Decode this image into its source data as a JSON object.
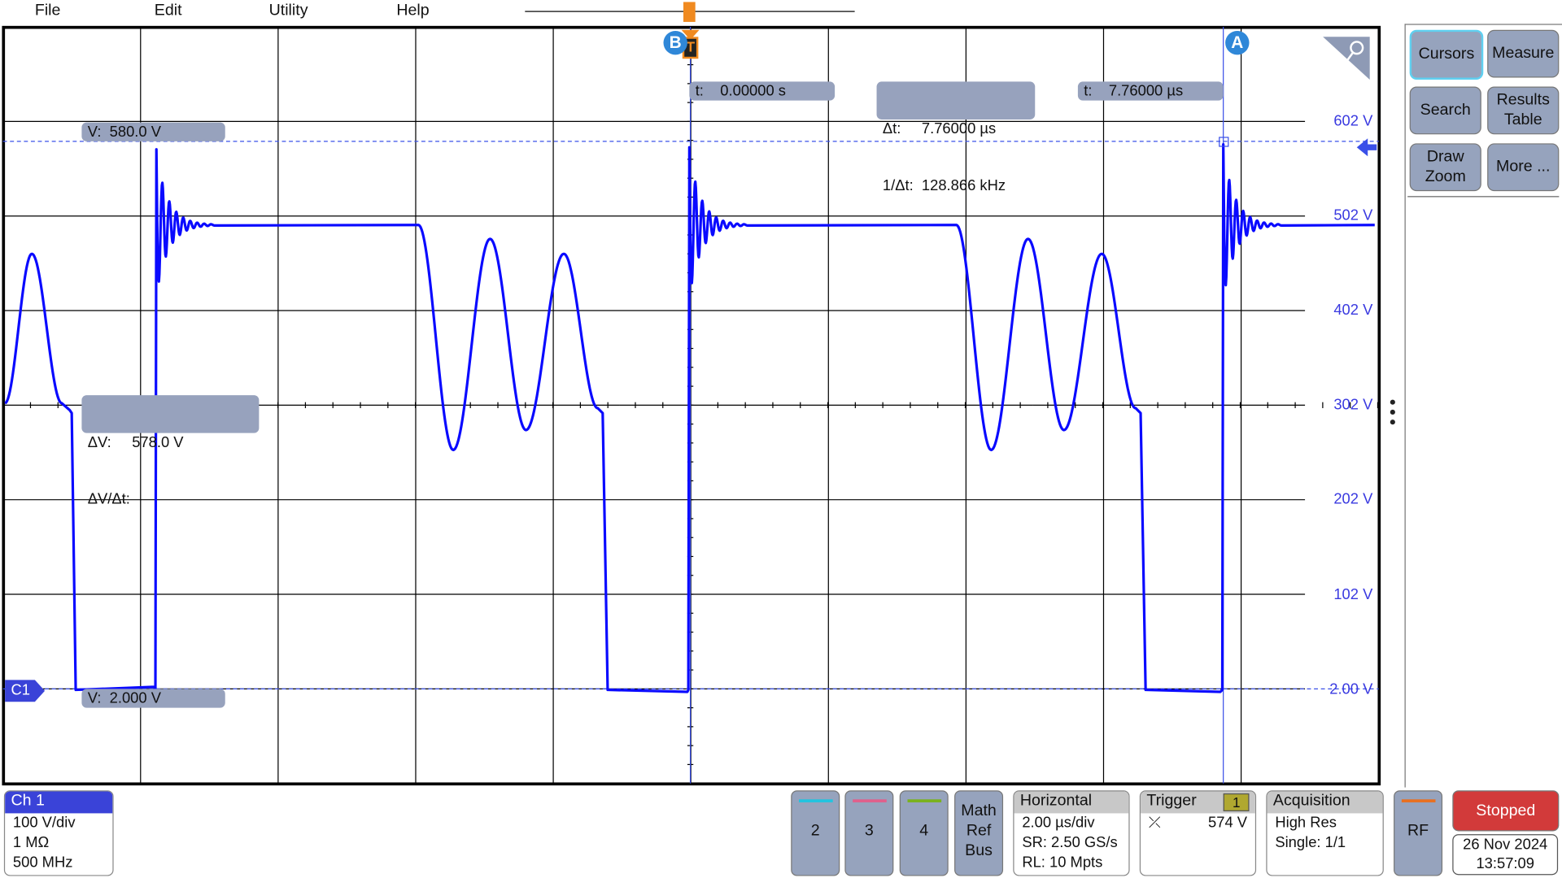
{
  "menu": [
    "File",
    "Edit",
    "Utility",
    "Help"
  ],
  "cursor_readouts": {
    "va": "V:  580.0 V",
    "dv": "ΔV:     578.0 V",
    "dvdt": "ΔV/Δt:",
    "vb": "V:  2.000 V",
    "tb": "t:    0.00000 s",
    "dt": "Δt:     7.76000 µs",
    "inv_dt": "1/Δt:  128.866 kHz",
    "ta": "t:    7.76000 µs"
  },
  "cursor_labels": {
    "a": "A",
    "b": "B",
    "trigger": "T"
  },
  "channel_marker": "C1",
  "scale_labels": [
    "602 V",
    "502 V",
    "402 V",
    "302 V",
    "202 V",
    "102 V",
    "2.00 V"
  ],
  "side_panel": [
    {
      "label": "Cursors",
      "active": true
    },
    {
      "label": "Measure"
    },
    {
      "label": "Search"
    },
    {
      "label": "Results Table"
    },
    {
      "label": "Draw Zoom"
    },
    {
      "label": "More ..."
    }
  ],
  "channel1": {
    "title": "Ch 1",
    "lines": [
      "100 V/div",
      "1 MΩ",
      "500 MHz"
    ],
    "color": "#3a43d8"
  },
  "channel_buttons": [
    {
      "label": "2",
      "color": "#22c4e0"
    },
    {
      "label": "3",
      "color": "#e0608c"
    },
    {
      "label": "4",
      "color": "#7ab21c"
    }
  ],
  "math_ref_bus": [
    "Math",
    "Ref",
    "Bus"
  ],
  "horizontal": {
    "title": "Horizontal",
    "lines": [
      "2.00 µs/div",
      "SR: 2.50 GS/s",
      "RL: 10 Mpts"
    ]
  },
  "trigger": {
    "title": "Trigger",
    "source": "1",
    "level": "574 V"
  },
  "acquisition": {
    "title": "Acquisition",
    "lines": [
      "High Res",
      "Single: 1/1"
    ]
  },
  "rf": {
    "label": "RF",
    "color": "#e87020"
  },
  "run_state": {
    "label": "Stopped",
    "color": "#d23a3a"
  },
  "datetime": {
    "date": "26 Nov 2024",
    "time": "13:57:09"
  },
  "colors": {
    "trace": "#0a0aff",
    "cursor": "#3a50e8",
    "readout_bg": "#97a2bd"
  }
}
